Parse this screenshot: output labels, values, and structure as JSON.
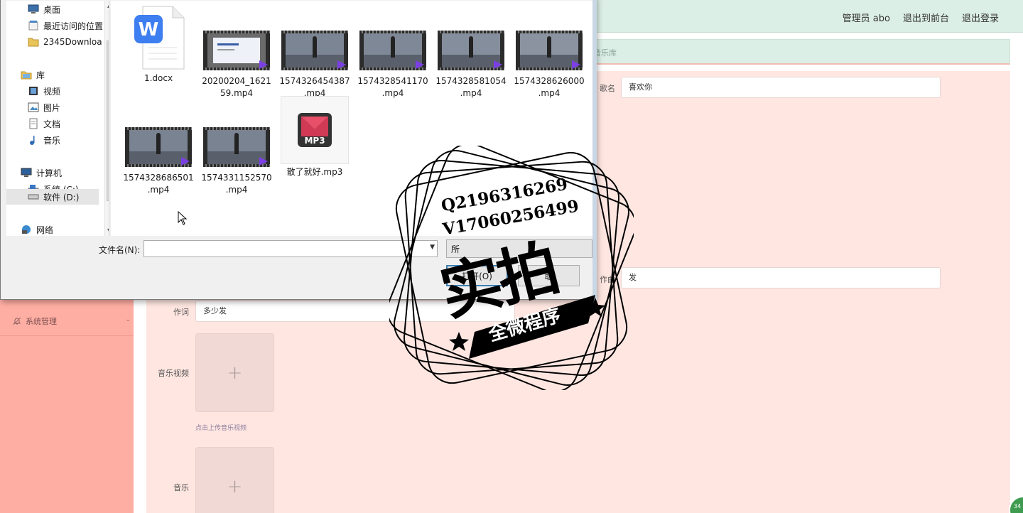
{
  "topbar": {
    "admin_label": "管理员 abo",
    "front_label": "退出到前台",
    "logout_label": "退出登录"
  },
  "breadcrumb": {
    "text": "音乐库"
  },
  "sidebar": {
    "system_label": "系统管理"
  },
  "form": {
    "song_name_label": "歌名",
    "song_name_value": "喜欢你",
    "composer_label": "作曲",
    "composer_value": "发",
    "lyricist_label": "作词",
    "lyricist_value": "多少发",
    "video_label": "音乐视频",
    "video_hint": "点击上传音乐视频",
    "music_label": "音乐",
    "plus": "+"
  },
  "dialog": {
    "nav_items": [
      {
        "label": "桌面",
        "icon": "desktop-icon"
      },
      {
        "label": "最近访问的位置",
        "icon": "recent-places-icon"
      },
      {
        "label": "2345Downloa",
        "icon": "folder-icon"
      },
      {
        "label": "库",
        "icon": "library-icon"
      },
      {
        "label": "视频",
        "icon": "videos-icon"
      },
      {
        "label": "图片",
        "icon": "pictures-icon"
      },
      {
        "label": "文档",
        "icon": "documents-icon"
      },
      {
        "label": "音乐",
        "icon": "music-icon"
      },
      {
        "label": "计算机",
        "icon": "computer-icon"
      },
      {
        "label": "系统 (C:)",
        "icon": "drive-c-icon"
      },
      {
        "label": "软件 (D:)",
        "icon": "drive-d-icon"
      },
      {
        "label": "网络",
        "icon": "network-icon"
      }
    ],
    "files": [
      {
        "name_line1": "1.docx",
        "name_line2": "",
        "type": "docx"
      },
      {
        "name_line1": "20200204_1621",
        "name_line2": "59.mp4",
        "type": "video"
      },
      {
        "name_line1": "1574326454387",
        "name_line2": ".mp4",
        "type": "video"
      },
      {
        "name_line1": "1574328541170",
        "name_line2": ".mp4",
        "type": "video"
      },
      {
        "name_line1": "1574328581054",
        "name_line2": ".mp4",
        "type": "video"
      },
      {
        "name_line1": "1574328626000",
        "name_line2": ".mp4",
        "type": "video"
      },
      {
        "name_line1": "1574328686501",
        "name_line2": ".mp4",
        "type": "video"
      },
      {
        "name_line1": "1574331152570",
        "name_line2": ".mp4",
        "type": "video"
      },
      {
        "name_line1": "散了就好.mp3",
        "name_line2": "",
        "type": "mp3"
      }
    ],
    "filename_label": "文件名(N):",
    "filename_value": "",
    "filter_label": "所",
    "open_label": "打开(O)",
    "cancel_label": "取",
    "mp3_badge": "MP3"
  },
  "watermark": {
    "line1": "Q2196316269",
    "line2": "V17060256499",
    "big": "实拍",
    "ribbon": "全微程序"
  },
  "corner_badge": "34"
}
